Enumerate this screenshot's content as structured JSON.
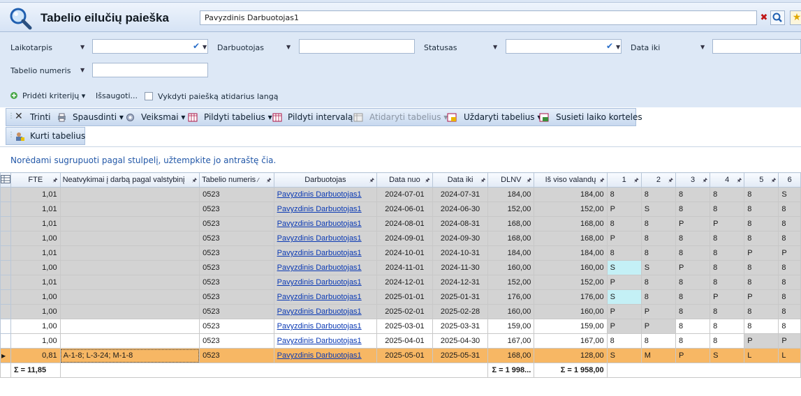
{
  "header": {
    "title": "Tabelio eilučių paieška",
    "search_value": "Pavyzdinis Darbuotojas1"
  },
  "filters": {
    "row1": [
      "Laikotarpis",
      "Darbuotojas",
      "Statusas",
      "Data iki"
    ],
    "row2": [
      "Tabelio numeris"
    ],
    "add_criteria": "Pridėti kriterijų",
    "save": "Išsaugoti...",
    "run_on_open": "Vykdyti paiešką atidarius langą"
  },
  "toolbar": {
    "delete": "Trinti",
    "print": "Spausdinti",
    "actions": "Veiksmai",
    "fill_timesheets": "Pildyti tabelius",
    "fill_interval": "Pildyti intervalą",
    "open_timesheets": "Atidaryti tabelius",
    "close_timesheets": "Uždaryti tabelius",
    "link_cards": "Susieti laiko korteles",
    "create_timesheets": "Kurti tabelius"
  },
  "group_hint": "Norėdami sugrupuoti pagal stulpelį, užtempkite jo antraštę čia.",
  "grid": {
    "columns": [
      "FTE",
      "Neatvykimai į darbą pagal valstybinį",
      "Tabelio numeris",
      "Darbuotojas",
      "Data nuo",
      "Data iki",
      "DLNV",
      "Iš viso valandų",
      "1",
      "2",
      "3",
      "4",
      "5",
      "6"
    ],
    "rows": [
      {
        "fte": "1,01",
        "abs": "",
        "num": "0523",
        "emp": "Pavyzdinis Darbuotojas1",
        "from": "2024-07-01",
        "to": "2024-07-31",
        "dlnv": "184,00",
        "total": "184,00",
        "d": [
          "8",
          "8",
          "8",
          "8",
          "8",
          "S"
        ]
      },
      {
        "fte": "1,01",
        "abs": "",
        "num": "0523",
        "emp": "Pavyzdinis Darbuotojas1",
        "from": "2024-06-01",
        "to": "2024-06-30",
        "dlnv": "152,00",
        "total": "152,00",
        "d": [
          "P",
          "S",
          "8",
          "8",
          "8",
          "8"
        ]
      },
      {
        "fte": "1,01",
        "abs": "",
        "num": "0523",
        "emp": "Pavyzdinis Darbuotojas1",
        "from": "2024-08-01",
        "to": "2024-08-31",
        "dlnv": "168,00",
        "total": "168,00",
        "d": [
          "8",
          "8",
          "P",
          "P",
          "8",
          "8"
        ]
      },
      {
        "fte": "1,00",
        "abs": "",
        "num": "0523",
        "emp": "Pavyzdinis Darbuotojas1",
        "from": "2024-09-01",
        "to": "2024-09-30",
        "dlnv": "168,00",
        "total": "168,00",
        "d": [
          "P",
          "8",
          "8",
          "8",
          "8",
          "8"
        ]
      },
      {
        "fte": "1,01",
        "abs": "",
        "num": "0523",
        "emp": "Pavyzdinis Darbuotojas1",
        "from": "2024-10-01",
        "to": "2024-10-31",
        "dlnv": "184,00",
        "total": "184,00",
        "d": [
          "8",
          "8",
          "8",
          "8",
          "P",
          "P"
        ]
      },
      {
        "fte": "1,00",
        "abs": "",
        "num": "0523",
        "emp": "Pavyzdinis Darbuotojas1",
        "from": "2024-11-01",
        "to": "2024-11-30",
        "dlnv": "160,00",
        "total": "160,00",
        "d": [
          "S",
          "S",
          "P",
          "8",
          "8",
          "8"
        ]
      },
      {
        "fte": "1,01",
        "abs": "",
        "num": "0523",
        "emp": "Pavyzdinis Darbuotojas1",
        "from": "2024-12-01",
        "to": "2024-12-31",
        "dlnv": "152,00",
        "total": "152,00",
        "d": [
          "P",
          "8",
          "8",
          "8",
          "8",
          "8"
        ]
      },
      {
        "fte": "1,00",
        "abs": "",
        "num": "0523",
        "emp": "Pavyzdinis Darbuotojas1",
        "from": "2025-01-01",
        "to": "2025-01-31",
        "dlnv": "176,00",
        "total": "176,00",
        "d": [
          "S",
          "8",
          "8",
          "P",
          "P",
          "8"
        ]
      },
      {
        "fte": "1,00",
        "abs": "",
        "num": "0523",
        "emp": "Pavyzdinis Darbuotojas1",
        "from": "2025-02-01",
        "to": "2025-02-28",
        "dlnv": "160,00",
        "total": "160,00",
        "d": [
          "P",
          "P",
          "8",
          "8",
          "8",
          "8"
        ]
      },
      {
        "fte": "1,00",
        "abs": "",
        "num": "0523",
        "emp": "Pavyzdinis Darbuotojas1",
        "from": "2025-03-01",
        "to": "2025-03-31",
        "dlnv": "159,00",
        "total": "159,00",
        "d": [
          "P",
          "P",
          "8",
          "8",
          "8",
          "8"
        ]
      },
      {
        "fte": "1,00",
        "abs": "",
        "num": "0523",
        "emp": "Pavyzdinis Darbuotojas1",
        "from": "2025-04-01",
        "to": "2025-04-30",
        "dlnv": "167,00",
        "total": "167,00",
        "d": [
          "8",
          "8",
          "8",
          "8",
          "P",
          "P"
        ]
      },
      {
        "fte": "0,81",
        "abs": "A-1-8; L-3-24; M-1-8",
        "num": "0523",
        "emp": "Pavyzdinis Darbuotojas1",
        "from": "2025-05-01",
        "to": "2025-05-31",
        "dlnv": "168,00",
        "total": "128,00",
        "d": [
          "S",
          "M",
          "P",
          "S",
          "L",
          "L"
        ]
      }
    ],
    "footer": {
      "fte": "Σ = 11,85",
      "dlnv": "Σ = 1 998...",
      "total": "Σ = 1 958,00"
    }
  }
}
